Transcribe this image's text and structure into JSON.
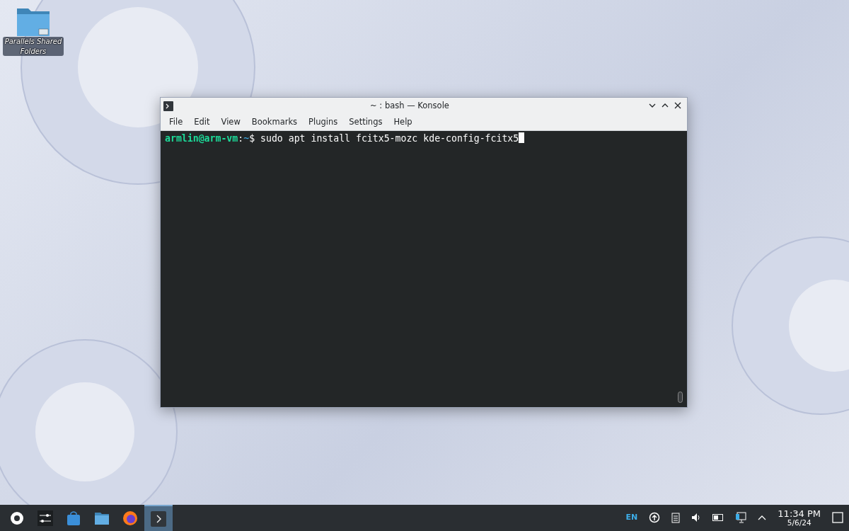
{
  "desktop_icons": [
    {
      "label": "Parallels Shared Folders"
    }
  ],
  "window": {
    "title": "~ : bash — Konsole",
    "menu": [
      "File",
      "Edit",
      "View",
      "Bookmarks",
      "Plugins",
      "Settings",
      "Help"
    ],
    "terminal": {
      "user_host": "armlin@arm-vm",
      "separator": ":",
      "path": "~",
      "symbol": "$",
      "command": "sudo apt install fcitx5-mozc kde-config-fcitx5"
    }
  },
  "taskbar": {
    "tasks": [
      {
        "kind": "launcher",
        "selected": false
      },
      {
        "kind": "settings",
        "selected": false
      },
      {
        "kind": "store",
        "selected": false
      },
      {
        "kind": "files",
        "selected": false
      },
      {
        "kind": "browser",
        "selected": false
      },
      {
        "kind": "terminal",
        "selected": true
      }
    ],
    "tray": {
      "language": "EN",
      "time": "11:34 PM",
      "date": "5/6/24"
    }
  }
}
